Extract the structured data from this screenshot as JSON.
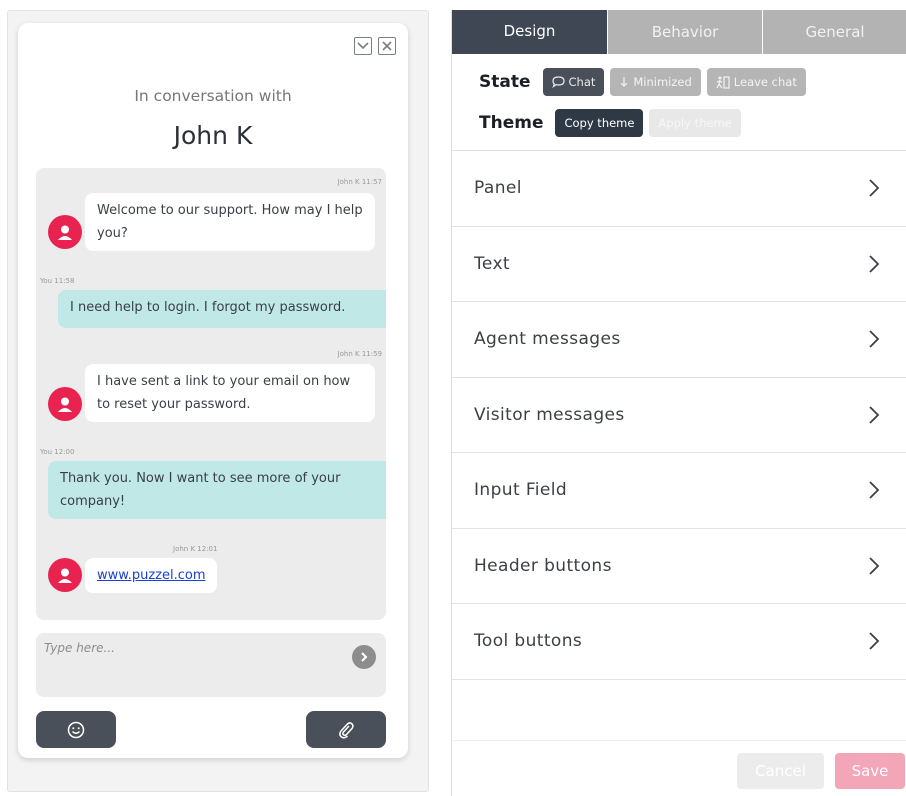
{
  "chat": {
    "conversation_with": "In conversation with",
    "agent_name": "John K",
    "messages": [
      {
        "from": "agent",
        "timestamp": "John K 11:57",
        "text": "Welcome to our support. How may I help you?"
      },
      {
        "from": "visitor",
        "timestamp": "You 11:58",
        "text": "I need help to login. I forgot my password."
      },
      {
        "from": "agent",
        "timestamp": "John K 11:59",
        "text": "I have sent a link to your email on how to reset your password."
      },
      {
        "from": "visitor",
        "timestamp": "You 12:00",
        "text": "Thank you. Now I want to see more of your company!"
      },
      {
        "from": "agent",
        "timestamp": "John K 12:01",
        "text": "www.puzzel.com",
        "is_link": true
      }
    ],
    "input_placeholder": "Type here...",
    "colors": {
      "avatar": "#e8234f",
      "visitor_bubble": "#bfe8e6",
      "link": "#1a3fd8"
    }
  },
  "settings": {
    "tabs": [
      {
        "label": "Design",
        "active": true
      },
      {
        "label": "Behavior",
        "active": false
      },
      {
        "label": "General",
        "active": false
      }
    ],
    "state_label": "State",
    "state_buttons": [
      {
        "label": "Chat",
        "icon": "chat-bubble-icon",
        "active": true
      },
      {
        "label": "Minimized",
        "icon": "arrow-down-icon",
        "active": false
      },
      {
        "label": "Leave chat",
        "icon": "leave-icon",
        "active": false
      }
    ],
    "theme_label": "Theme",
    "theme_buttons": [
      {
        "label": "Copy theme",
        "enabled": true
      },
      {
        "label": "Apply theme",
        "enabled": false
      }
    ],
    "sections": [
      "Panel",
      "Text",
      "Agent messages",
      "Visitor messages",
      "Input Field",
      "Header buttons",
      "Tool buttons"
    ],
    "cancel_label": "Cancel",
    "save_label": "Save",
    "colors": {
      "active_tab": "#3e4753",
      "save": "#f2a6b8"
    }
  }
}
